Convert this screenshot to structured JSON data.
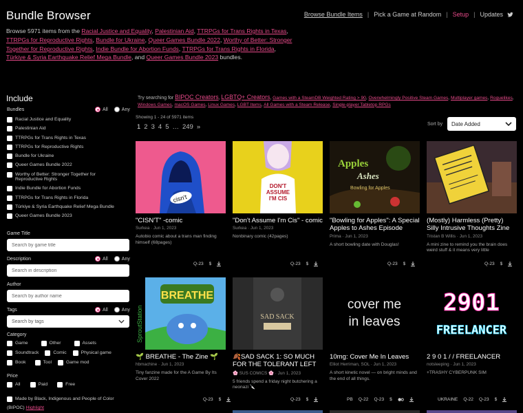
{
  "header": {
    "title": "Bundle Browser",
    "nav": [
      "Browse Bundle Items",
      "Pick a Game at Random",
      "Setup",
      "Updates"
    ]
  },
  "intro": {
    "prefix": "Browse 5971 items from the",
    "bundles": [
      "Racial Justice and Equality",
      "Palestinian Aid",
      "TTRPGs for Trans Rights in Texas",
      "TTRPGs for Reproductive Rights",
      "Bundle for Ukraine",
      "Queer Games Bundle 2022",
      "Worthy of Better: Stronger Together for Reproductive Rights",
      "Indie Bundle for Abortion Funds",
      "TTRPGs for Trans Rights in Florida",
      "Türkiye & Syria Earthquake Relief Mega Bundle"
    ],
    "and": "and",
    "last_bundle": "Queer Games Bundle 2023",
    "suffix": "bundles."
  },
  "sidebar": {
    "include": "Include",
    "bundles_label": "Bundles",
    "all": "All",
    "any": "Any",
    "bundle_items": [
      "Racial Justice and Equality",
      "Palestinian Aid",
      "TTRPGs for Trans Rights in Texas",
      "TTRPGs for Reproductive Rights",
      "Bundle for Ukraine",
      "Queer Games Bundle 2022",
      "Worthy of Better: Stronger Together for Reproductive Rights",
      "Indie Bundle for Abortion Funds",
      "TTRPGs for Trans Rights in Florida",
      "Türkiye & Syria Earthquake Relief Mega Bundle",
      "Queer Games Bundle 2023"
    ],
    "game_title_label": "Game Title",
    "game_title_placeholder": "Search by game title",
    "description_label": "Description",
    "description_placeholder": "Search in description",
    "author_label": "Author",
    "author_placeholder": "Search by author name",
    "tags_label": "Tags",
    "tags_placeholder": "Search by tags",
    "category_label": "Category",
    "categories": [
      "Game",
      "Other",
      "Assets",
      "Soundtrack",
      "Comic",
      "Physical game",
      "Book",
      "Tool",
      "Game mod"
    ],
    "price_label": "Price",
    "prices": [
      "All",
      "Paid",
      "Free"
    ],
    "bipoc_label": "Made by Black, Indigenous and People of Color",
    "bipoc_sub": "(BIPOC)",
    "bipoc_link": "Highlight"
  },
  "results": {
    "try_label": "Try searching for",
    "suggest_big": [
      "BIPOC Creators",
      "LGBTQ+ Creators"
    ],
    "suggest": [
      "Games with a SteamDB Weighted Rating > 90",
      "Overwhelmingly Positive Steam Games",
      "Multiplayer games",
      "Roguelikes",
      "Windows Games",
      "macOS Games",
      "Linux Games",
      "LGBT Items",
      "All Games with a Steam Release",
      "Single-player Tabletop RPGs"
    ],
    "showing": "Showing 1 - 24 of 5971 items",
    "pages": [
      "1",
      "2",
      "3",
      "4",
      "5",
      "…",
      "249",
      "»"
    ],
    "sort_label": "Sort by",
    "sort_value": "Date Added"
  },
  "cards": [
    {
      "title": "\"CISN'T\" -comic",
      "meta": "Surkea · Jun 1, 2023",
      "desc": "Autobio comic about a trans man finding himself (68pages)",
      "foot": [
        "Q-23",
        "$"
      ]
    },
    {
      "title": "\"Don't Assume I'm Cis\" - comic",
      "meta": "Surkea · Jun 1, 2023",
      "desc": "Nonbinary comic (42pages)",
      "foot": [
        "Q-23",
        "$"
      ]
    },
    {
      "title": "\"Bowling for Apples\": A Special Apples to Ashes Episode",
      "meta": "Prima · Jun 1, 2023",
      "desc": "A short bowling date with Douglas!",
      "foot": [
        "Q-23",
        "$"
      ]
    },
    {
      "title": "(Mostly) Harmless (Pretty) Silly Intrusive Thoughts Zine",
      "meta": "Tristan B Willis · Jun 1, 2023",
      "desc": "A mini zine to remind you the brain does weird stuff & it means very little",
      "foot": [
        "Q-23",
        "$"
      ]
    },
    {
      "title": "🌱 BREATHE - The Zine 🌱",
      "meta": "hbmachine · Jun 1, 2023",
      "desc": "Tiny fanzine made for the A Game By Its Cover 2022",
      "foot": [
        "Q-23",
        "$"
      ]
    },
    {
      "title": "🍂SAD SACK 1: SO MUCH FOR THE TOLERANT LEFT",
      "meta": "🌸 SUS COMICS 🌸 · Jun 1, 2023",
      "desc": "5 friends spend a friday night butchering a neonazi 🔪",
      "foot": [
        "Q-23",
        "$"
      ]
    },
    {
      "title": "10mg: Cover Me In Leaves",
      "meta": "Elliot Herriman, SOL · Jun 1, 2023",
      "desc": "A short kinetic novel — on bright minds and the end of all things.",
      "foot": [
        "PB",
        "Q-22",
        "Q-23",
        "$"
      ]
    },
    {
      "title": "2 9 0 1 / / FREELANCER",
      "meta": "notsleeping · Jun 1, 2023",
      "desc": "+TRASHY CYBERPUNK SIM",
      "foot": [
        "UKRAINE",
        "Q-22",
        "Q-23",
        "$"
      ]
    }
  ],
  "thumb_text": {
    "cover3": "Apples to Ashes",
    "cover3_sub": "Bowling for Apples",
    "cover5": "BREATHE",
    "cover5_side": "SproutStation",
    "cover6": "SAD SACK",
    "cover7": "cover me in leaves",
    "cover8_big": "2901",
    "cover8_small": "FREELANCER",
    "cover2_shirt": "DON'T ASSUME I'M CIS"
  },
  "colors": {
    "accent": "#e84a8a",
    "background": "#000000",
    "card_pink": "#ee5a8e",
    "card_yellow": "#e8d11c"
  }
}
